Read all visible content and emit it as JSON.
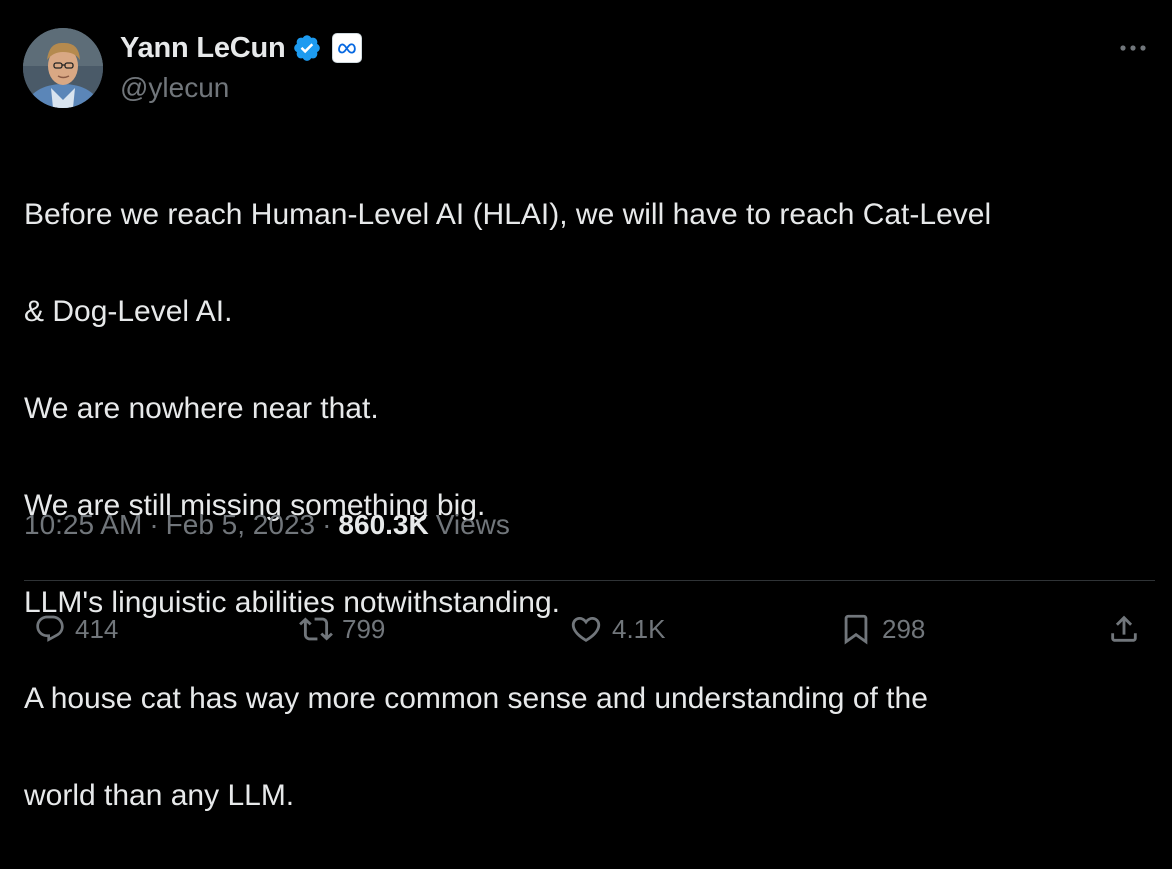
{
  "author": {
    "display_name": "Yann LeCun",
    "handle": "@ylecun",
    "verified_icon": "verified-badge-icon",
    "affiliation_icon": "meta-logo-icon",
    "verified_color": "#1d9bf0"
  },
  "tweet": {
    "text_lines": [
      "Before we reach Human-Level AI (HLAI), we will have to reach Cat-Level",
      "& Dog-Level AI.",
      "We are nowhere near that.",
      "We are still missing something big.",
      "LLM's linguistic abilities notwithstanding.",
      "A house cat has way more common sense and understanding of the",
      "world than any LLM."
    ],
    "time": "10:25 AM",
    "date": "Feb 5, 2023",
    "views_count": "860.3K",
    "views_label": "Views"
  },
  "actions": {
    "replies": "414",
    "reposts": "799",
    "likes": "4.1K",
    "bookmarks": "298"
  },
  "colors": {
    "background": "#000000",
    "text": "#e7e9ea",
    "muted": "#71767b",
    "divider": "#2f3336"
  }
}
